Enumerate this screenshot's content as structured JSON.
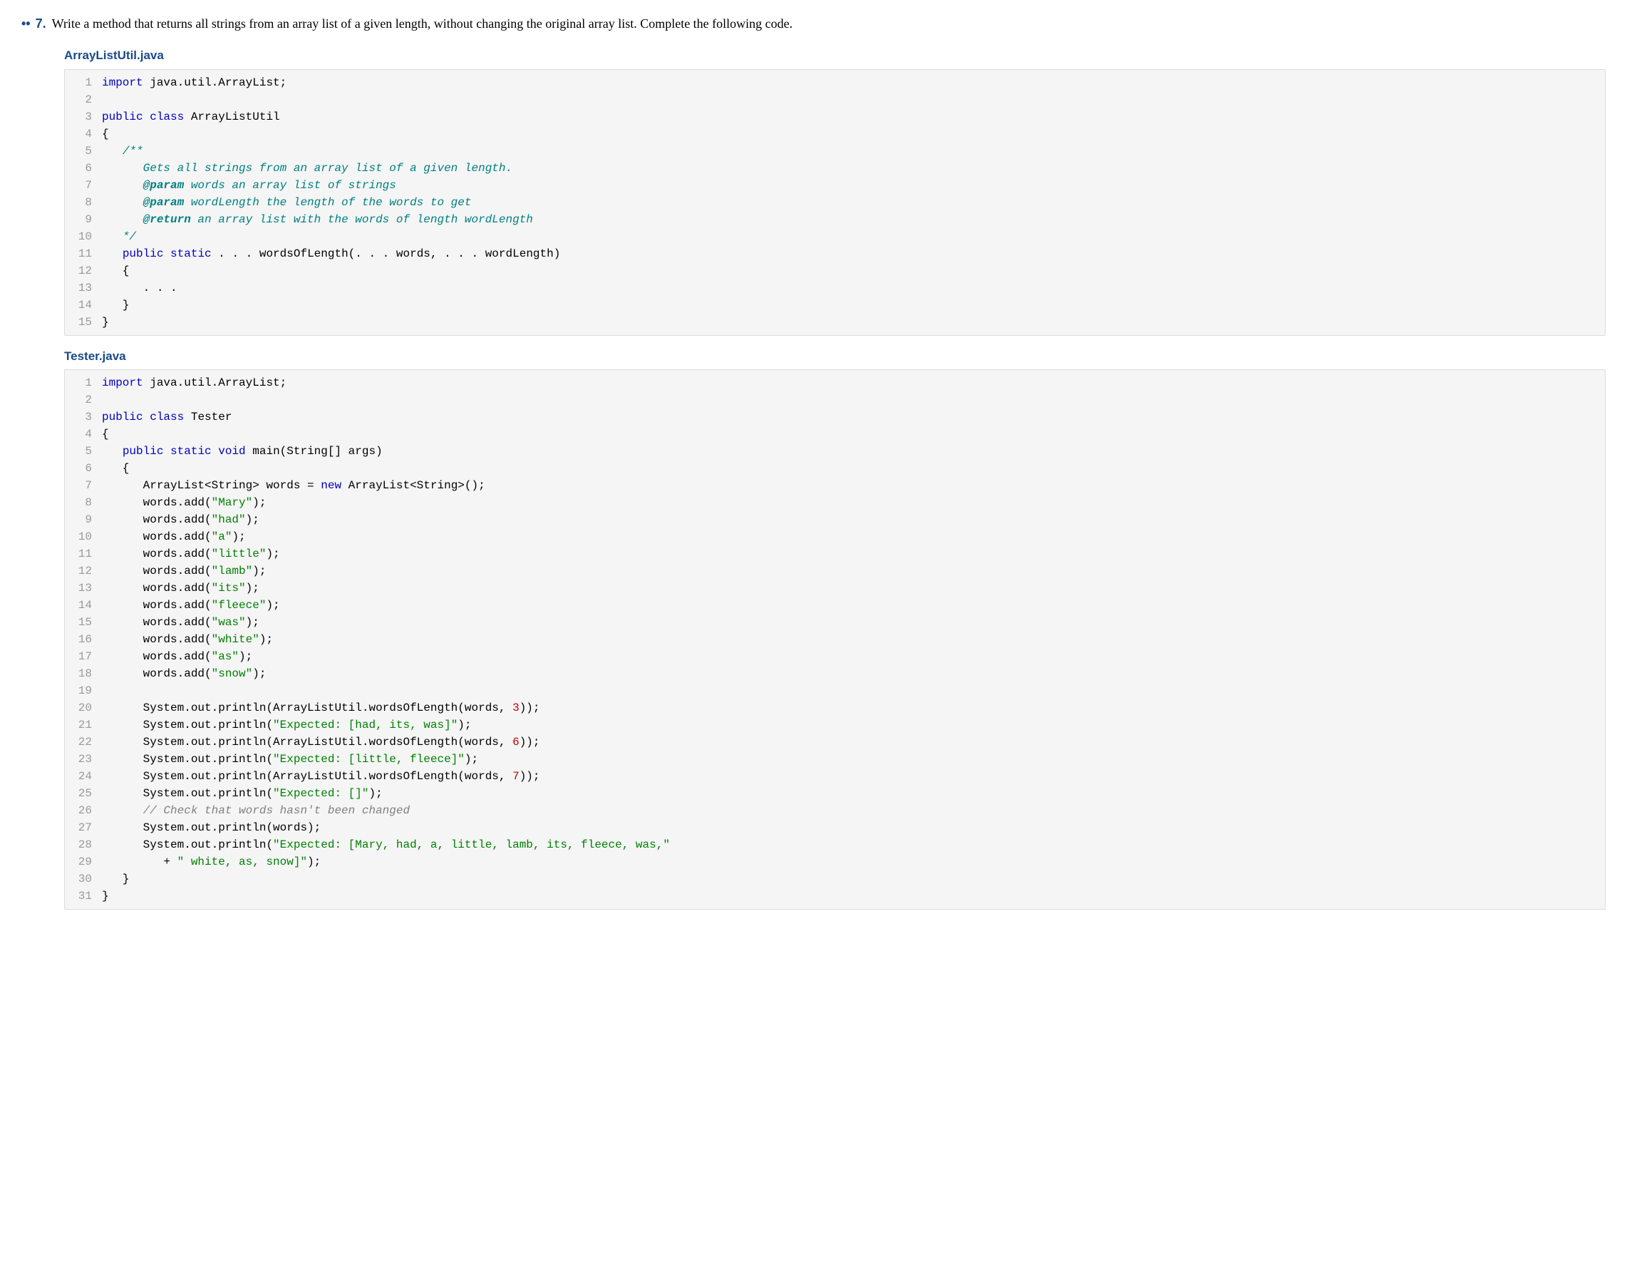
{
  "question": {
    "dots": "••",
    "number": "7.",
    "text": "Write a method that returns all strings from an array list of a given length, without changing the original array list. Complete the following code."
  },
  "files": [
    {
      "name": "ArrayListUtil.java",
      "lines": [
        {
          "n": "1",
          "tokens": [
            {
              "t": "import",
              "c": "kw"
            },
            {
              "t": " java.util.ArrayList;"
            }
          ]
        },
        {
          "n": "2",
          "tokens": []
        },
        {
          "n": "3",
          "tokens": [
            {
              "t": "public",
              "c": "kw"
            },
            {
              "t": " "
            },
            {
              "t": "class",
              "c": "kw"
            },
            {
              "t": " ArrayListUtil"
            }
          ]
        },
        {
          "n": "4",
          "tokens": [
            {
              "t": "{"
            }
          ]
        },
        {
          "n": "5",
          "tokens": [
            {
              "t": "   "
            },
            {
              "t": "/**",
              "c": "doccomment"
            }
          ]
        },
        {
          "n": "6",
          "tokens": [
            {
              "t": "      "
            },
            {
              "t": "Gets all strings from an array list of a given length.",
              "c": "doccomment"
            }
          ]
        },
        {
          "n": "7",
          "tokens": [
            {
              "t": "      "
            },
            {
              "t": "@param",
              "c": "docparam"
            },
            {
              "t": " words an array list of strings",
              "c": "doccomment"
            }
          ]
        },
        {
          "n": "8",
          "tokens": [
            {
              "t": "      "
            },
            {
              "t": "@param",
              "c": "docparam"
            },
            {
              "t": " wordLength the length of the words to get",
              "c": "doccomment"
            }
          ]
        },
        {
          "n": "9",
          "tokens": [
            {
              "t": "      "
            },
            {
              "t": "@return",
              "c": "docparam"
            },
            {
              "t": " an array list with the words of length wordLength",
              "c": "doccomment"
            }
          ]
        },
        {
          "n": "10",
          "tokens": [
            {
              "t": "   "
            },
            {
              "t": "*/",
              "c": "doccomment"
            }
          ]
        },
        {
          "n": "11",
          "tokens": [
            {
              "t": "   "
            },
            {
              "t": "public",
              "c": "kw"
            },
            {
              "t": " "
            },
            {
              "t": "static",
              "c": "kw"
            },
            {
              "t": " . . . wordsOfLength(. . . words, . . . wordLength)"
            }
          ]
        },
        {
          "n": "12",
          "tokens": [
            {
              "t": "   {"
            }
          ]
        },
        {
          "n": "13",
          "tokens": [
            {
              "t": "      . . ."
            }
          ]
        },
        {
          "n": "14",
          "tokens": [
            {
              "t": "   }"
            }
          ]
        },
        {
          "n": "15",
          "tokens": [
            {
              "t": "}"
            }
          ]
        }
      ]
    },
    {
      "name": "Tester.java",
      "lines": [
        {
          "n": "1",
          "tokens": [
            {
              "t": "import",
              "c": "kw"
            },
            {
              "t": " java.util.ArrayList;"
            }
          ]
        },
        {
          "n": "2",
          "tokens": []
        },
        {
          "n": "3",
          "tokens": [
            {
              "t": "public",
              "c": "kw"
            },
            {
              "t": " "
            },
            {
              "t": "class",
              "c": "kw"
            },
            {
              "t": " Tester"
            }
          ]
        },
        {
          "n": "4",
          "tokens": [
            {
              "t": "{"
            }
          ]
        },
        {
          "n": "5",
          "tokens": [
            {
              "t": "   "
            },
            {
              "t": "public",
              "c": "kw"
            },
            {
              "t": " "
            },
            {
              "t": "static",
              "c": "kw"
            },
            {
              "t": " "
            },
            {
              "t": "void",
              "c": "kw"
            },
            {
              "t": " main(String[] args)"
            }
          ]
        },
        {
          "n": "6",
          "tokens": [
            {
              "t": "   {"
            }
          ]
        },
        {
          "n": "7",
          "tokens": [
            {
              "t": "      ArrayList<String> words = "
            },
            {
              "t": "new",
              "c": "kw"
            },
            {
              "t": " ArrayList<String>();"
            }
          ]
        },
        {
          "n": "8",
          "tokens": [
            {
              "t": "      words.add("
            },
            {
              "t": "\"Mary\"",
              "c": "str"
            },
            {
              "t": ");"
            }
          ]
        },
        {
          "n": "9",
          "tokens": [
            {
              "t": "      words.add("
            },
            {
              "t": "\"had\"",
              "c": "str"
            },
            {
              "t": ");"
            }
          ]
        },
        {
          "n": "10",
          "tokens": [
            {
              "t": "      words.add("
            },
            {
              "t": "\"a\"",
              "c": "str"
            },
            {
              "t": ");"
            }
          ]
        },
        {
          "n": "11",
          "tokens": [
            {
              "t": "      words.add("
            },
            {
              "t": "\"little\"",
              "c": "str"
            },
            {
              "t": ");"
            }
          ]
        },
        {
          "n": "12",
          "tokens": [
            {
              "t": "      words.add("
            },
            {
              "t": "\"lamb\"",
              "c": "str"
            },
            {
              "t": ");"
            }
          ]
        },
        {
          "n": "13",
          "tokens": [
            {
              "t": "      words.add("
            },
            {
              "t": "\"its\"",
              "c": "str"
            },
            {
              "t": ");"
            }
          ]
        },
        {
          "n": "14",
          "tokens": [
            {
              "t": "      words.add("
            },
            {
              "t": "\"fleece\"",
              "c": "str"
            },
            {
              "t": ");"
            }
          ]
        },
        {
          "n": "15",
          "tokens": [
            {
              "t": "      words.add("
            },
            {
              "t": "\"was\"",
              "c": "str"
            },
            {
              "t": ");"
            }
          ]
        },
        {
          "n": "16",
          "tokens": [
            {
              "t": "      words.add("
            },
            {
              "t": "\"white\"",
              "c": "str"
            },
            {
              "t": ");"
            }
          ]
        },
        {
          "n": "17",
          "tokens": [
            {
              "t": "      words.add("
            },
            {
              "t": "\"as\"",
              "c": "str"
            },
            {
              "t": ");"
            }
          ]
        },
        {
          "n": "18",
          "tokens": [
            {
              "t": "      words.add("
            },
            {
              "t": "\"snow\"",
              "c": "str"
            },
            {
              "t": ");"
            }
          ]
        },
        {
          "n": "19",
          "tokens": []
        },
        {
          "n": "20",
          "tokens": [
            {
              "t": "      System.out.println(ArrayListUtil.wordsOfLength(words, "
            },
            {
              "t": "3",
              "c": "num"
            },
            {
              "t": "));"
            }
          ]
        },
        {
          "n": "21",
          "tokens": [
            {
              "t": "      System.out.println("
            },
            {
              "t": "\"Expected: [had, its, was]\"",
              "c": "str"
            },
            {
              "t": ");"
            }
          ]
        },
        {
          "n": "22",
          "tokens": [
            {
              "t": "      System.out.println(ArrayListUtil.wordsOfLength(words, "
            },
            {
              "t": "6",
              "c": "num"
            },
            {
              "t": "));"
            }
          ]
        },
        {
          "n": "23",
          "tokens": [
            {
              "t": "      System.out.println("
            },
            {
              "t": "\"Expected: [little, fleece]\"",
              "c": "str"
            },
            {
              "t": ");"
            }
          ]
        },
        {
          "n": "24",
          "tokens": [
            {
              "t": "      System.out.println(ArrayListUtil.wordsOfLength(words, "
            },
            {
              "t": "7",
              "c": "num"
            },
            {
              "t": "));"
            }
          ]
        },
        {
          "n": "25",
          "tokens": [
            {
              "t": "      System.out.println("
            },
            {
              "t": "\"Expected: []\"",
              "c": "str"
            },
            {
              "t": ");"
            }
          ]
        },
        {
          "n": "26",
          "tokens": [
            {
              "t": "      "
            },
            {
              "t": "// Check that words hasn't been changed",
              "c": "comment"
            }
          ]
        },
        {
          "n": "27",
          "tokens": [
            {
              "t": "      System.out.println(words);"
            }
          ]
        },
        {
          "n": "28",
          "tokens": [
            {
              "t": "      System.out.println("
            },
            {
              "t": "\"Expected: [Mary, had, a, little, lamb, its, fleece, was,\"",
              "c": "str"
            }
          ]
        },
        {
          "n": "29",
          "tokens": [
            {
              "t": "         + "
            },
            {
              "t": "\" white, as, snow]\"",
              "c": "str"
            },
            {
              "t": ");"
            }
          ]
        },
        {
          "n": "30",
          "tokens": [
            {
              "t": "   }"
            }
          ]
        },
        {
          "n": "31",
          "tokens": [
            {
              "t": "}"
            }
          ]
        }
      ]
    }
  ]
}
